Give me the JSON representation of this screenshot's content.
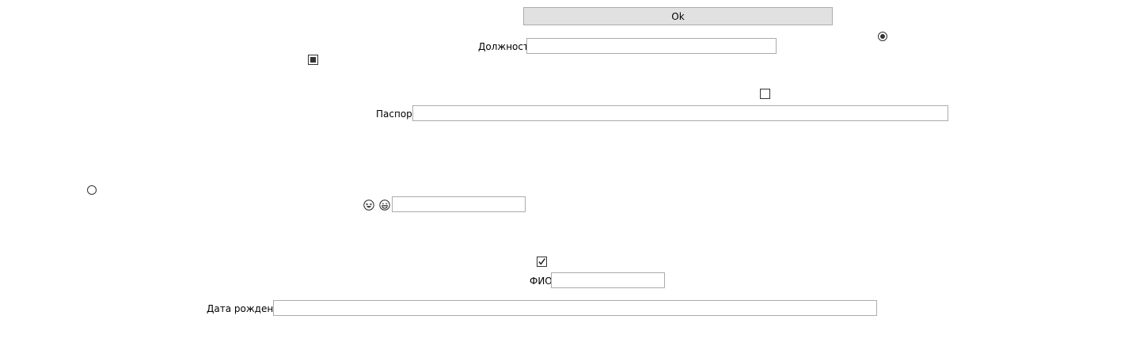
{
  "form": {
    "ok_button": "Ok",
    "position_label": "Должность",
    "position_value": "",
    "passport_label": "Паспорт",
    "passport_value": "",
    "emoji_field_value": "",
    "fio_label": "ФИО",
    "fio_value": "",
    "birthdate_label": "Дата рождения",
    "birthdate_value": ""
  },
  "controls": {
    "radio_top_right": {
      "checked": true
    },
    "radio_left": {
      "checked": false
    },
    "checkbox_indeterminate": {
      "state": "indeterminate"
    },
    "checkbox_empty": {
      "checked": false
    },
    "checkbox_checked": {
      "checked": true
    }
  },
  "icons": {
    "emoji_1": "laughing-face-icon",
    "emoji_2": "grinning-face-icon"
  }
}
